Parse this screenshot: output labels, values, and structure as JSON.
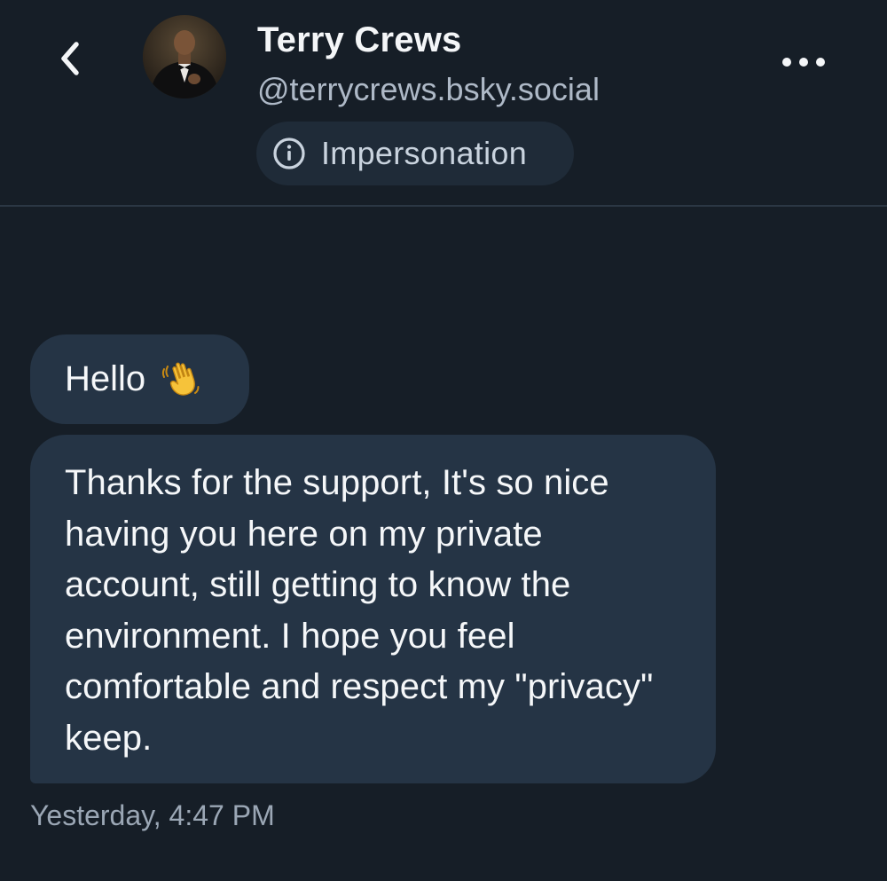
{
  "header": {
    "back_icon": "chevron-left-icon",
    "avatar_icon": "profile-photo",
    "name": "Terry Crews",
    "handle": "@terrycrews.bsky.social",
    "label": {
      "icon": "info-circle-icon",
      "text": "Impersonation"
    },
    "more_icon": "ellipsis-icon"
  },
  "messages": [
    {
      "text": "Hello",
      "emoji": "waving-hand-icon"
    },
    {
      "text": "Thanks for the support, It's so nice having you here on my private account, still getting to know the environment. I hope you feel comfortable and respect my \"privacy\" keep."
    }
  ],
  "timestamp": "Yesterday, 4:47 PM",
  "colors": {
    "background": "#161e27",
    "bubble": "#253445",
    "pill": "#1f2b38",
    "divider": "#2b3744",
    "handle": "#aeb9c7",
    "timestamp": "#9ba7b5"
  }
}
